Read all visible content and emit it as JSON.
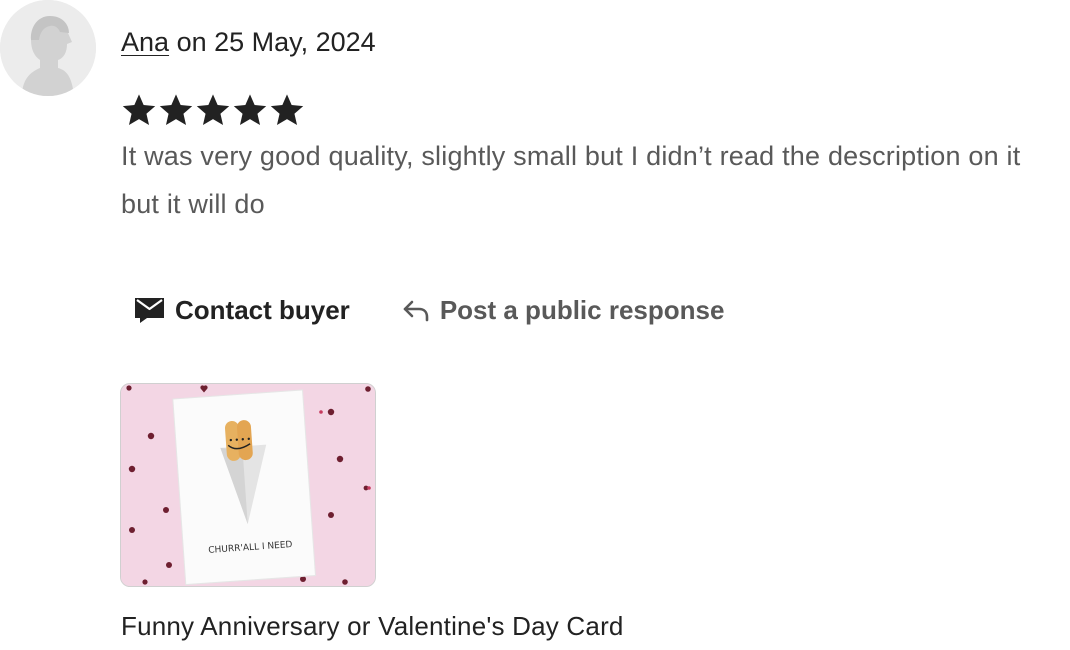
{
  "review": {
    "author_name": "Ana",
    "date_text": "on 25 May, 2024",
    "rating": 5,
    "rating_max": 5,
    "text": "It was very good quality, slightly small but I didn’t read the description on it but it will do"
  },
  "actions": {
    "contact_label": "Contact buyer",
    "public_response_label": "Post a public response"
  },
  "listing": {
    "card_caption": "CHURR'ALL I NEED",
    "title": "Funny Anniversary or Valentine's Day Card"
  },
  "colors": {
    "text_primary": "#222222",
    "text_secondary": "#595959",
    "star": "#222222",
    "thumb_background": "#f3d6e4"
  }
}
